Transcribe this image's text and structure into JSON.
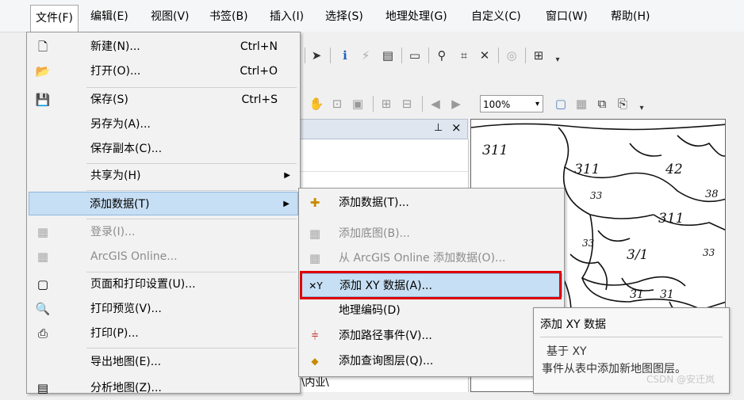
{
  "menubar": {
    "items": [
      "文件(F)",
      "编辑(E)",
      "视图(V)",
      "书签(B)",
      "插入(I)",
      "选择(S)",
      "地理处理(G)",
      "自定义(C)",
      "窗口(W)",
      "帮助(H)"
    ]
  },
  "file_menu": {
    "new": {
      "label": "新建(N)...",
      "shortcut": "Ctrl+N"
    },
    "open": {
      "label": "打开(O)...",
      "shortcut": "Ctrl+O"
    },
    "save": {
      "label": "保存(S)",
      "shortcut": "Ctrl+S"
    },
    "save_as": {
      "label": "另存为(A)..."
    },
    "save_copy": {
      "label": "保存副本(C)..."
    },
    "share_as": {
      "label": "共享为(H)"
    },
    "add_data": {
      "label": "添加数据(T)"
    },
    "sign_in": {
      "label": "登录(I)..."
    },
    "arcgis_online": {
      "label": "ArcGIS Online..."
    },
    "page_setup": {
      "label": "页面和打印设置(U)..."
    },
    "print_preview": {
      "label": "打印预览(V)..."
    },
    "print": {
      "label": "打印(P)..."
    },
    "export_map": {
      "label": "导出地图(E)..."
    },
    "analyze_map": {
      "label": "分析地图(Z)..."
    }
  },
  "add_data_submenu": {
    "add_data": "添加数据(T)...",
    "add_basemap": "添加底图(B)...",
    "add_from_online": "从 ArcGIS Online 添加数据(O)...",
    "add_xy": "添加 XY 数据(A)...",
    "geocode": "地理编码(D)",
    "add_route_events": "添加路径事件(V)...",
    "add_query_layer": "添加查询图层(Q)..."
  },
  "toolbar": {
    "zoom_value": "100%"
  },
  "toc_panel": {
    "pin": "ᆞ",
    "close": "×"
  },
  "tooltip": {
    "title": "添加 XY 数据",
    "line1": "基于 XY",
    "line2": "事件从表中添加新地图图层。"
  },
  "map": {
    "labels": [
      "311",
      "311",
      "42",
      "33",
      "38",
      "311",
      "33",
      "3/1",
      "33",
      "31",
      "31"
    ]
  },
  "watermark": "CSDN @安迁岚",
  "colors": {
    "highlight": "#c7dff4",
    "callout": "#e00000"
  }
}
